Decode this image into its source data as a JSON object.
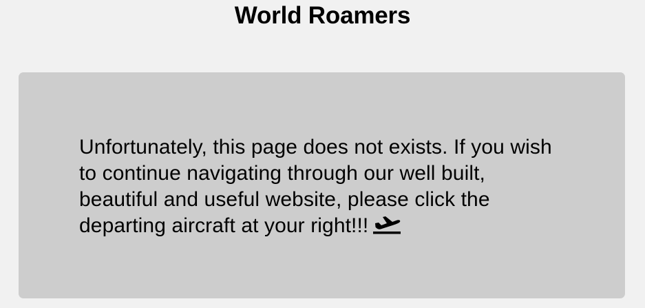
{
  "header": {
    "title": "World Roamers"
  },
  "error_card": {
    "message": "Unfortunately, this page does not exists. If you wish to continue navigating through our well built, beautiful and useful website, please click the departing aircraft at your right!!!",
    "link_icon": "plane-departure-icon"
  },
  "colors": {
    "background": "#f1f1f1",
    "card": "#cdcdcd",
    "text": "#000000"
  }
}
